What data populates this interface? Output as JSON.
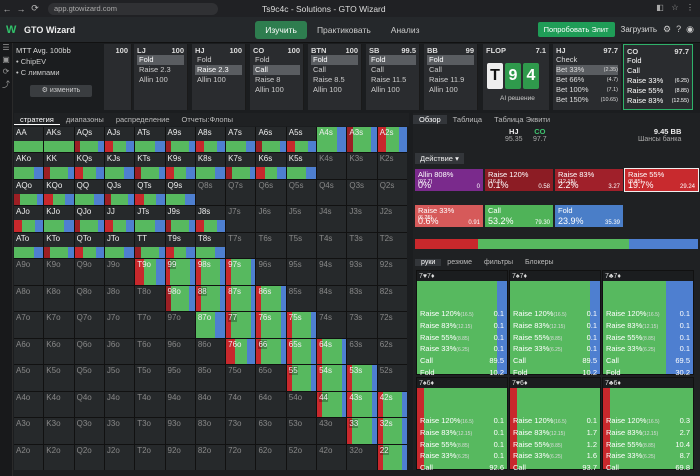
{
  "browser": {
    "url": "app.gtowizard.com",
    "title": "Ts9c4c - Solutions - GTO Wizard"
  },
  "app": {
    "brand": "GTO Wizard",
    "tabs": [
      "Изучить",
      "Практиковать",
      "Анализ"
    ],
    "upgrade": "Попробовать Элит",
    "load": "Загрузить"
  },
  "config": {
    "title": "MTT Avg. 100bb",
    "opt1": "ChipEV",
    "opt2": "С лимпами",
    "change": "изменить"
  },
  "positions": [
    {
      "name": "",
      "stack": "100",
      "options": []
    },
    {
      "name": "LJ",
      "stack": "100",
      "options": [
        "Fold",
        "Raise 2.3",
        "Allin 100"
      ],
      "sel": 0
    },
    {
      "name": "HJ",
      "stack": "100",
      "options": [
        "Fold",
        "Raise 2.3",
        "Allin 100"
      ],
      "sel": 1
    },
    {
      "name": "CO",
      "stack": "100",
      "options": [
        "Fold",
        "Call",
        "Raise 8",
        "Allin 100"
      ],
      "sel": 1
    },
    {
      "name": "BTN",
      "stack": "100",
      "options": [
        "Fold",
        "Call",
        "Raise 8.5",
        "Allin 100"
      ],
      "sel": 0
    },
    {
      "name": "SB",
      "stack": "99.5",
      "options": [
        "Fold",
        "Call",
        "Raise 11.5",
        "Allin 100"
      ],
      "sel": 0
    },
    {
      "name": "BB",
      "stack": "99",
      "options": [
        "Fold",
        "Call",
        "Raise 11.9",
        "Allin 100"
      ],
      "sel": 0
    }
  ],
  "flop": {
    "label": "FLOP",
    "stack": "7.1",
    "cards": [
      "T",
      "9",
      "4"
    ],
    "ai": "AI решение"
  },
  "sbcol": {
    "name": "HJ",
    "stack": "97.7",
    "options": [
      {
        "l": "Check",
        "v": ""
      },
      {
        "l": "Bet 33%",
        "v": "(2.35)"
      },
      {
        "l": "Bet 66%",
        "v": "(4.7)"
      },
      {
        "l": "Bet 100%",
        "v": "(7.1)"
      },
      {
        "l": "Bet 150%",
        "v": "(10.65)"
      }
    ]
  },
  "cocol": {
    "name": "CO",
    "stack": "97.7",
    "options": [
      {
        "l": "Fold",
        "v": ""
      },
      {
        "l": "Call",
        "v": ""
      },
      {
        "l": "Raise 33%",
        "v": "(6.25)"
      },
      {
        "l": "Raise 55%",
        "v": "(8.85)"
      },
      {
        "l": "Raise 83%",
        "v": "(12.55)"
      }
    ]
  },
  "lefttabs": [
    "стратегия",
    "диапазоны",
    "распределение",
    "Отчеты:Флопы"
  ],
  "grid": [
    [
      "AA",
      "AKs",
      "AQs",
      "AJs",
      "ATs",
      "A9s",
      "A8s",
      "A7s",
      "A6s",
      "A5s",
      "A4s",
      "A3s",
      "A2s"
    ],
    [
      "AKo",
      "KK",
      "KQs",
      "KJs",
      "KTs",
      "K9s",
      "K8s",
      "K7s",
      "K6s",
      "K5s",
      "K4s",
      "K3s",
      "K2s"
    ],
    [
      "AQo",
      "KQo",
      "QQ",
      "QJs",
      "QTs",
      "Q9s",
      "Q8s",
      "Q7s",
      "Q6s",
      "Q5s",
      "Q4s",
      "Q3s",
      "Q2s"
    ],
    [
      "AJo",
      "KJo",
      "QJo",
      "JJ",
      "JTs",
      "J9s",
      "J8s",
      "J7s",
      "J6s",
      "J5s",
      "J4s",
      "J3s",
      "J2s"
    ],
    [
      "ATo",
      "KTo",
      "QTo",
      "JTo",
      "TT",
      "T9s",
      "T8s",
      "T7s",
      "T6s",
      "T5s",
      "T4s",
      "T3s",
      "T2s"
    ],
    [
      "A9o",
      "K9o",
      "Q9o",
      "J9o",
      "T9o",
      "99",
      "98s",
      "97s",
      "96s",
      "95s",
      "94s",
      "93s",
      "92s"
    ],
    [
      "A8o",
      "K8o",
      "Q8o",
      "J8o",
      "T8o",
      "98o",
      "88",
      "87s",
      "86s",
      "85s",
      "84s",
      "83s",
      "82s"
    ],
    [
      "A7o",
      "K7o",
      "Q7o",
      "J7o",
      "T7o",
      "97o",
      "87o",
      "77",
      "76s",
      "75s",
      "74s",
      "73s",
      "72s"
    ],
    [
      "A6o",
      "K6o",
      "Q6o",
      "J6o",
      "T6o",
      "96o",
      "86o",
      "76o",
      "66",
      "65s",
      "64s",
      "63s",
      "62s"
    ],
    [
      "A5o",
      "K5o",
      "Q5o",
      "J5o",
      "T5o",
      "95o",
      "85o",
      "75o",
      "65o",
      "55",
      "54s",
      "53s",
      "52s"
    ],
    [
      "A4o",
      "K4o",
      "Q4o",
      "J4o",
      "T4o",
      "94o",
      "84o",
      "74o",
      "64o",
      "54o",
      "44",
      "43s",
      "42s"
    ],
    [
      "A3o",
      "K3o",
      "Q3o",
      "J3o",
      "T3o",
      "93o",
      "83o",
      "73o",
      "63o",
      "53o",
      "43o",
      "33",
      "32s"
    ],
    [
      "A2o",
      "K2o",
      "Q2o",
      "J2o",
      "T2o",
      "92o",
      "82o",
      "72o",
      "62o",
      "52o",
      "42o",
      "32o",
      "22"
    ]
  ],
  "righttabs": [
    "Обзор",
    "Таблица",
    "Таблица Эквити"
  ],
  "stats": [
    {
      "l": "",
      "v": ""
    },
    {
      "l": "",
      "v": ""
    },
    {
      "l": "",
      "v": ""
    },
    {
      "l": "HJ",
      "v": "95.35"
    },
    {
      "l": "CO",
      "v": "97.7"
    }
  ],
  "pot": "9.45 BB",
  "pot_sub": "Шансы банка",
  "actions_label": "Действие",
  "actions": [
    {
      "name": "Allin 808%",
      "sub": "(97.7)",
      "pct": "0%",
      "combos": "0",
      "fr": "0",
      "color": "#7a2a8c"
    },
    {
      "name": "Raise 120%",
      "sub": "(16.5)",
      "pct": "0.1%",
      "combos": "0.58",
      "fr": "0",
      "color": "#8c1c24"
    },
    {
      "name": "Raise 83%",
      "sub": "(12.15)",
      "pct": "2.2%",
      "combos": "3.27",
      "fr": "",
      "color": "#a0202a"
    },
    {
      "name": "Raise 55%",
      "sub": "(8.85)",
      "pct": "19.7%",
      "combos": "29.24",
      "fr": "",
      "color": "#c82a2e"
    },
    {
      "name": "Raise 33%",
      "sub": "(6.25)",
      "pct": "0.6%",
      "combos": "0.91",
      "fr": "",
      "color": "#d65a5a"
    },
    {
      "name": "Call",
      "sub": "",
      "pct": "53.2%",
      "combos": "79.30",
      "fr": "",
      "color": "#4fb358"
    },
    {
      "name": "Fold",
      "sub": "",
      "pct": "23.9%",
      "combos": "35.39",
      "fr": "",
      "color": "#4a7ec8"
    }
  ],
  "subtabs": [
    "руки",
    "резюме",
    "фильтры",
    "Блокеры"
  ],
  "hands": [
    {
      "suits": "7♥7♦",
      "lines": [
        [
          "Raise 120%",
          "(16.5)",
          "0.1"
        ],
        [
          "Raise 83%",
          "(12.15)",
          "0.1"
        ],
        [
          "Raise 55%",
          "(8.85)",
          "0.1"
        ],
        [
          "Raise 33%",
          "(6.25)",
          "0.1"
        ],
        [
          "Call",
          "",
          "89.5"
        ],
        [
          "Fold",
          "",
          "10.2"
        ]
      ]
    },
    {
      "suits": "7♠7♦",
      "lines": [
        [
          "Raise 120%",
          "(16.5)",
          "0.1"
        ],
        [
          "Raise 83%",
          "(12.15)",
          "0.1"
        ],
        [
          "Raise 55%",
          "(8.85)",
          "0.1"
        ],
        [
          "Raise 33%",
          "(6.25)",
          "0.1"
        ],
        [
          "Call",
          "",
          "89.5"
        ],
        [
          "Fold",
          "",
          "10.2"
        ]
      ]
    },
    {
      "suits": "7♣7♦",
      "lines": [
        [
          "Raise 120%",
          "(16.5)",
          "0.1"
        ],
        [
          "Raise 83%",
          "(12.15)",
          "0.1"
        ],
        [
          "Raise 55%",
          "(8.85)",
          "0.1"
        ],
        [
          "Raise 33%",
          "(6.25)",
          "0.1"
        ],
        [
          "Call",
          "",
          "69.5"
        ],
        [
          "Fold",
          "",
          "30.2"
        ]
      ]
    },
    {
      "suits": "7♠6♦",
      "lines": [
        [
          "Raise 120%",
          "(16.5)",
          "0.1"
        ],
        [
          "Raise 83%",
          "(12.15)",
          "0.1"
        ],
        [
          "Raise 55%",
          "(8.85)",
          "0.1"
        ],
        [
          "Raise 33%",
          "(6.25)",
          "0.1"
        ],
        [
          "Call",
          "",
          "92.6"
        ],
        [
          "Fold",
          "",
          ""
        ]
      ]
    },
    {
      "suits": "7♥6♦",
      "lines": [
        [
          "Raise 120%",
          "(16.5)",
          "0.1"
        ],
        [
          "Raise 83%",
          "(12.15)",
          "1.7"
        ],
        [
          "Raise 55%",
          "(8.85)",
          "1.2"
        ],
        [
          "Raise 33%",
          "(6.25)",
          "1.6"
        ],
        [
          "Call",
          "",
          "93.7"
        ],
        [
          "Fold",
          "",
          ""
        ]
      ]
    },
    {
      "suits": "7♣6♦",
      "lines": [
        [
          "Raise 120%",
          "(16.5)",
          "0.3"
        ],
        [
          "Raise 83%",
          "(12.15)",
          "2.7"
        ],
        [
          "Raise 55%",
          "(8.85)",
          "10.4"
        ],
        [
          "Raise 33%",
          "(6.25)",
          "8.7"
        ],
        [
          "Call",
          "",
          "69.8"
        ],
        [
          "Fold",
          "",
          ""
        ]
      ]
    }
  ]
}
